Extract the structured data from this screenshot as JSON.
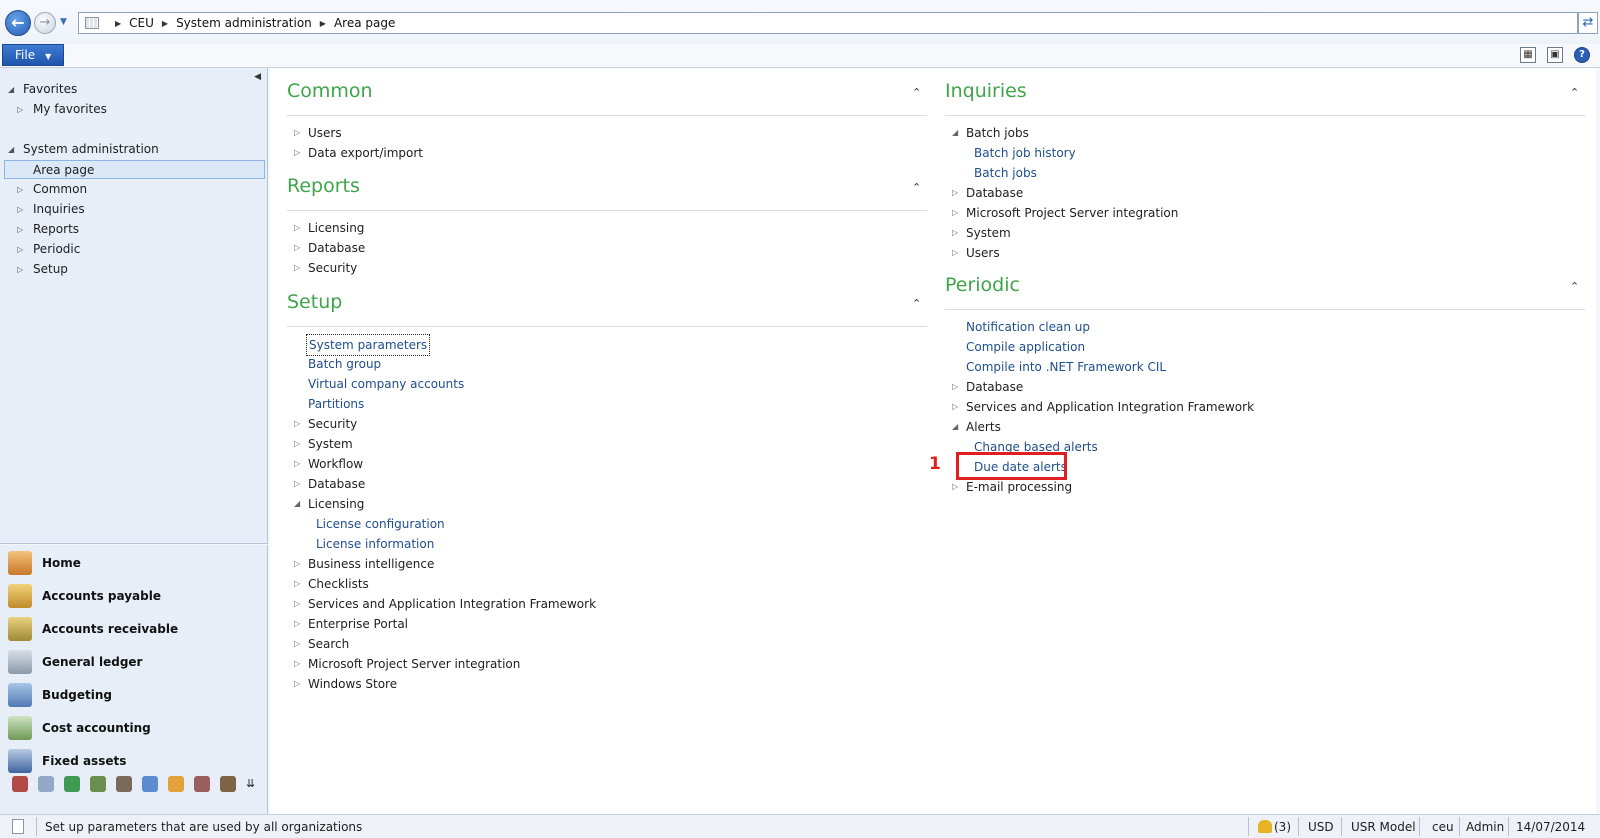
{
  "address": {
    "crumbs": [
      "CEU",
      "System administration",
      "Area page"
    ]
  },
  "ribbon": {
    "file_label": "File"
  },
  "nav_tree": [
    {
      "label": "Favorites",
      "level": 0,
      "expanded": true
    },
    {
      "label": "My favorites",
      "level": 1,
      "expanded": false
    },
    {
      "label": "System administration",
      "level": 0,
      "expanded": true
    },
    {
      "label": "Area page",
      "level": 1,
      "selected": true
    },
    {
      "label": "Common",
      "level": 1,
      "expanded": false
    },
    {
      "label": "Inquiries",
      "level": 1,
      "expanded": false
    },
    {
      "label": "Reports",
      "level": 1,
      "expanded": false
    },
    {
      "label": "Periodic",
      "level": 1,
      "expanded": false
    },
    {
      "label": "Setup",
      "level": 1,
      "expanded": false
    }
  ],
  "modules": [
    "Home",
    "Accounts payable",
    "Accounts receivable",
    "General ledger",
    "Budgeting",
    "Cost accounting",
    "Fixed assets"
  ],
  "colors": {
    "section_title": "#3fa54a",
    "link": "#1f4e8c",
    "highlight": "#e02020"
  },
  "groups": {
    "common": {
      "title": "Common",
      "items": [
        {
          "label": "Users",
          "type": "folder"
        },
        {
          "label": "Data export/import",
          "type": "folder"
        }
      ]
    },
    "reports": {
      "title": "Reports",
      "items": [
        {
          "label": "Licensing",
          "type": "folder"
        },
        {
          "label": "Database",
          "type": "folder"
        },
        {
          "label": "Security",
          "type": "folder"
        }
      ]
    },
    "setup": {
      "title": "Setup",
      "items": [
        {
          "label": "System parameters",
          "type": "link"
        },
        {
          "label": "Batch group",
          "type": "link"
        },
        {
          "label": "Virtual company accounts",
          "type": "link"
        },
        {
          "label": "Partitions",
          "type": "link"
        },
        {
          "label": "Security",
          "type": "folder"
        },
        {
          "label": "System",
          "type": "folder"
        },
        {
          "label": "Workflow",
          "type": "folder"
        },
        {
          "label": "Database",
          "type": "folder"
        },
        {
          "label": "Licensing",
          "type": "open"
        },
        {
          "label": "License configuration",
          "type": "sublink"
        },
        {
          "label": "License information",
          "type": "sublink"
        },
        {
          "label": "Business intelligence",
          "type": "folder"
        },
        {
          "label": "Checklists",
          "type": "folder"
        },
        {
          "label": "Services and Application Integration Framework",
          "type": "folder"
        },
        {
          "label": "Enterprise Portal",
          "type": "folder"
        },
        {
          "label": "Search",
          "type": "folder"
        },
        {
          "label": "Microsoft Project Server integration",
          "type": "folder"
        },
        {
          "label": "Windows Store",
          "type": "folder"
        }
      ]
    },
    "inquiries": {
      "title": "Inquiries",
      "items": [
        {
          "label": "Batch jobs",
          "type": "open"
        },
        {
          "label": "Batch job history",
          "type": "sublink"
        },
        {
          "label": "Batch jobs",
          "type": "sublink"
        },
        {
          "label": "Database",
          "type": "folder"
        },
        {
          "label": "Microsoft Project Server integration",
          "type": "folder"
        },
        {
          "label": "System",
          "type": "folder"
        },
        {
          "label": "Users",
          "type": "folder"
        }
      ]
    },
    "periodic": {
      "title": "Periodic",
      "items": [
        {
          "label": "Notification clean up",
          "type": "link"
        },
        {
          "label": "Compile application",
          "type": "link"
        },
        {
          "label": "Compile into .NET Framework CIL",
          "type": "link"
        },
        {
          "label": "Database",
          "type": "folder"
        },
        {
          "label": "Services and Application Integration Framework",
          "type": "folder"
        },
        {
          "label": "Alerts",
          "type": "open"
        },
        {
          "label": "Change based alerts",
          "type": "sublink"
        },
        {
          "label": "Due date alerts",
          "type": "sublink"
        },
        {
          "label": "E-mail processing",
          "type": "folder"
        }
      ]
    }
  },
  "callout": {
    "number": "1"
  },
  "status": {
    "help_text": "Set up parameters that are used by all organizations",
    "notifications": "(3)",
    "currency": "USD",
    "model": "USR Model",
    "company": "ceu",
    "user": "Admin",
    "date": "14/07/2014"
  }
}
